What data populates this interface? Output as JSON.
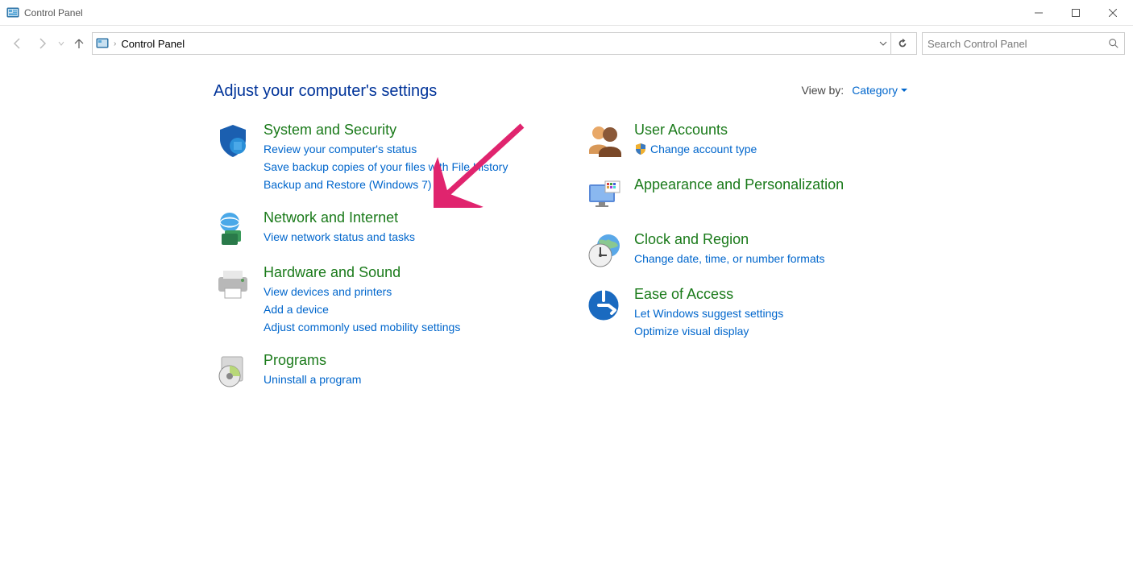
{
  "window": {
    "title": "Control Panel"
  },
  "addressbar": {
    "location": "Control Panel"
  },
  "search": {
    "placeholder": "Search Control Panel"
  },
  "heading": "Adjust your computer's settings",
  "viewby": {
    "label": "View by:",
    "value": "Category"
  },
  "cats": {
    "system": {
      "title": "System and Security",
      "l1": "Review your computer's status",
      "l2": "Save backup copies of your files with File History",
      "l3": "Backup and Restore (Windows 7)"
    },
    "network": {
      "title": "Network and Internet",
      "l1": "View network status and tasks"
    },
    "hardware": {
      "title": "Hardware and Sound",
      "l1": "View devices and printers",
      "l2": "Add a device",
      "l3": "Adjust commonly used mobility settings"
    },
    "programs": {
      "title": "Programs",
      "l1": "Uninstall a program"
    },
    "users": {
      "title": "User Accounts",
      "l1": "Change account type"
    },
    "appearance": {
      "title": "Appearance and Personalization"
    },
    "clock": {
      "title": "Clock and Region",
      "l1": "Change date, time, or number formats"
    },
    "ease": {
      "title": "Ease of Access",
      "l1": "Let Windows suggest settings",
      "l2": "Optimize visual display"
    }
  }
}
